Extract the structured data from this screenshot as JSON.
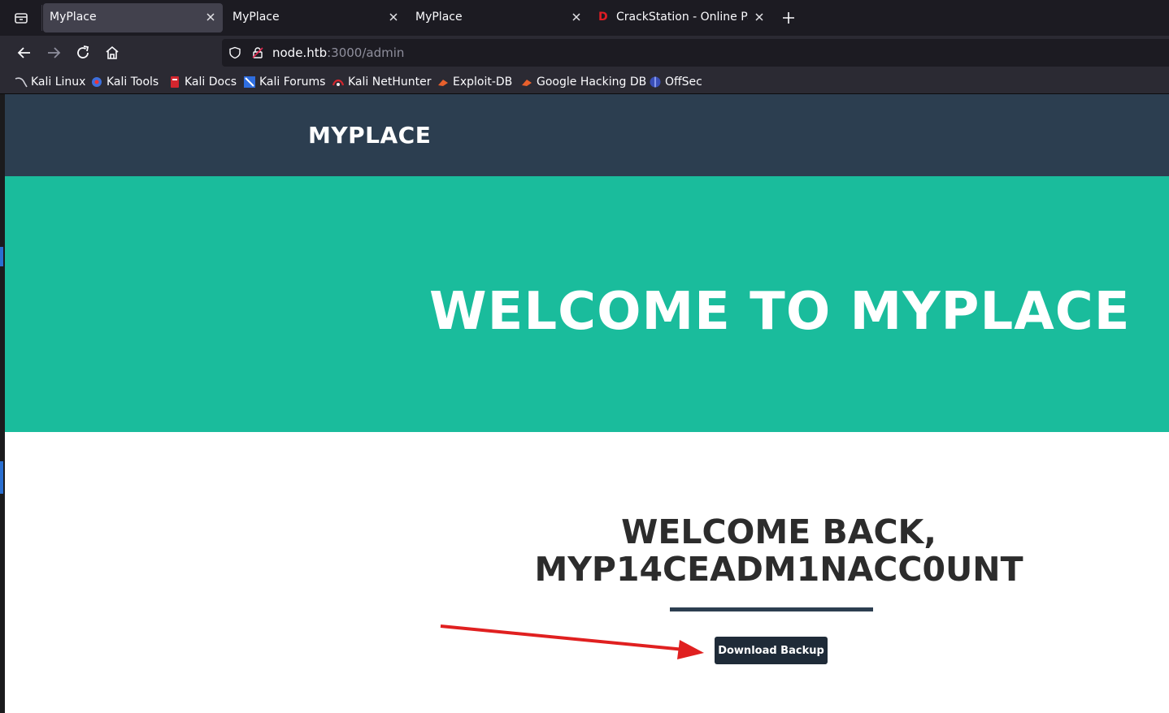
{
  "browser": {
    "tabs": [
      {
        "label": "MyPlace",
        "active": true
      },
      {
        "label": "MyPlace",
        "active": false
      },
      {
        "label": "MyPlace",
        "active": false
      },
      {
        "label": "CrackStation - Online Pas",
        "active": false,
        "favicon_text": "D"
      }
    ],
    "url": {
      "host": "node.htb",
      "rest": ":3000/admin"
    },
    "bookmarks": [
      {
        "label": "Kali Linux",
        "icon": "kali-dragon-icon"
      },
      {
        "label": "Kali Tools",
        "icon": "kali-tools-icon"
      },
      {
        "label": "Kali Docs",
        "icon": "kali-docs-icon"
      },
      {
        "label": "Kali Forums",
        "icon": "kali-forums-icon"
      },
      {
        "label": "Kali NetHunter",
        "icon": "kali-nethunter-icon"
      },
      {
        "label": "Exploit-DB",
        "icon": "exploit-db-icon"
      },
      {
        "label": "Google Hacking DB",
        "icon": "ghdb-icon"
      },
      {
        "label": "OffSec",
        "icon": "offsec-icon"
      }
    ]
  },
  "site": {
    "brand": "MYPLACE",
    "hero_title": "WELCOME TO MYPLACE",
    "welcome_line1": "WELCOME BACK,",
    "welcome_line2": "MYP14CEADM1NACC0UNT",
    "download_button": "Download Backup"
  },
  "colors": {
    "nav_bg": "#2c3e50",
    "hero_bg": "#1abc9c",
    "button_bg": "#1f2b38",
    "annotation_arrow": "#e02020"
  }
}
